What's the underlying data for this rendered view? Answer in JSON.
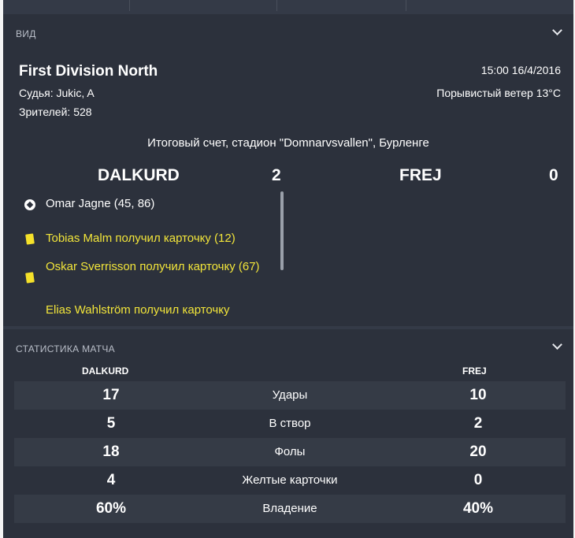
{
  "view_section": {
    "header": "ВИД",
    "competition": "First Division North",
    "referee": "Судья: Jukic, A",
    "attendance": "Зрителей: 528",
    "datetime": "15:00 16/4/2016",
    "weather": "Порывистый ветер 13°C",
    "result_text": "Итоговый счет, стадион \"Domnarvsvallen\", Бурленге",
    "home_team": "DALKURD",
    "home_score": "2",
    "away_team": "FREJ",
    "away_score": "0",
    "events": [
      {
        "type": "goal",
        "icon": "football-icon",
        "text": "Omar Jagne (45, 86)"
      },
      {
        "type": "yellow_card",
        "icon": "yellow-card-icon",
        "text": "Tobias Malm получил карточку (12)"
      },
      {
        "type": "yellow_card",
        "icon": "yellow-card-icon",
        "text": "Oskar Sverrisson получил карточку (67)"
      },
      {
        "type": "yellow_card",
        "icon": "yellow-card-icon",
        "text": "Elias Wahlström получил карточку"
      }
    ]
  },
  "stats_section": {
    "header": "СТАТИСТИКА МАТЧА",
    "home_team": "DALKURD",
    "away_team": "FREJ",
    "rows": [
      {
        "label": "Удары",
        "home": "17",
        "away": "10"
      },
      {
        "label": "В створ",
        "home": "5",
        "away": "2"
      },
      {
        "label": "Фолы",
        "home": "18",
        "away": "20"
      },
      {
        "label": "Желтые карточки",
        "home": "4",
        "away": "0"
      },
      {
        "label": "Владение",
        "home": "60%",
        "away": "40%"
      }
    ]
  },
  "colors": {
    "panel": "#2c313c",
    "background": "#343a47",
    "card_text": "#f2e53a"
  }
}
